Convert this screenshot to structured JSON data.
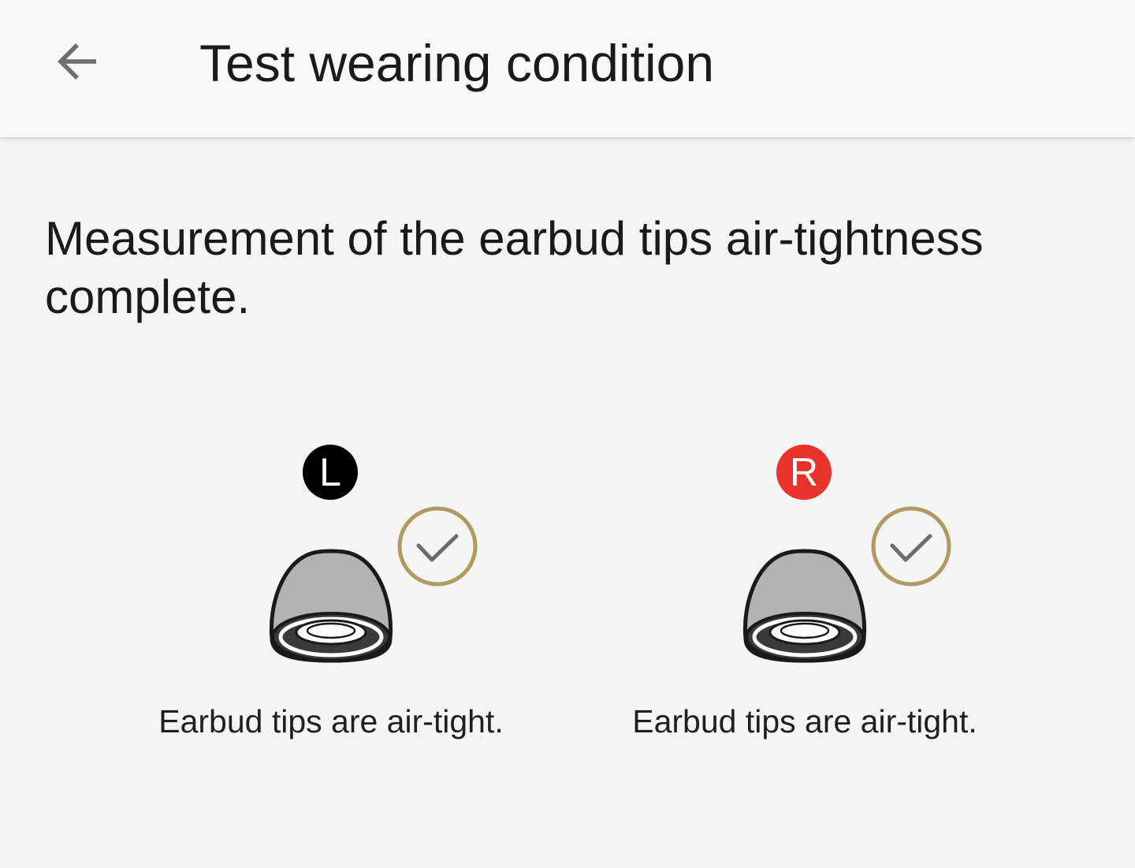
{
  "header": {
    "title": "Test wearing condition",
    "back_icon": "arrow-left-icon"
  },
  "main": {
    "message": "Measurement of the earbud tips air-tightness complete.",
    "earbuds": [
      {
        "side": "L",
        "badge_color": "#000000",
        "status": "Earbud tips are air-tight.",
        "status_icon": "check-circle-icon"
      },
      {
        "side": "R",
        "badge_color": "#e8332d",
        "status": "Earbud tips are air-tight.",
        "status_icon": "check-circle-icon"
      }
    ]
  },
  "colors": {
    "check_gold": "#b19a5f",
    "earbud_gray": "#b3b3b3"
  }
}
